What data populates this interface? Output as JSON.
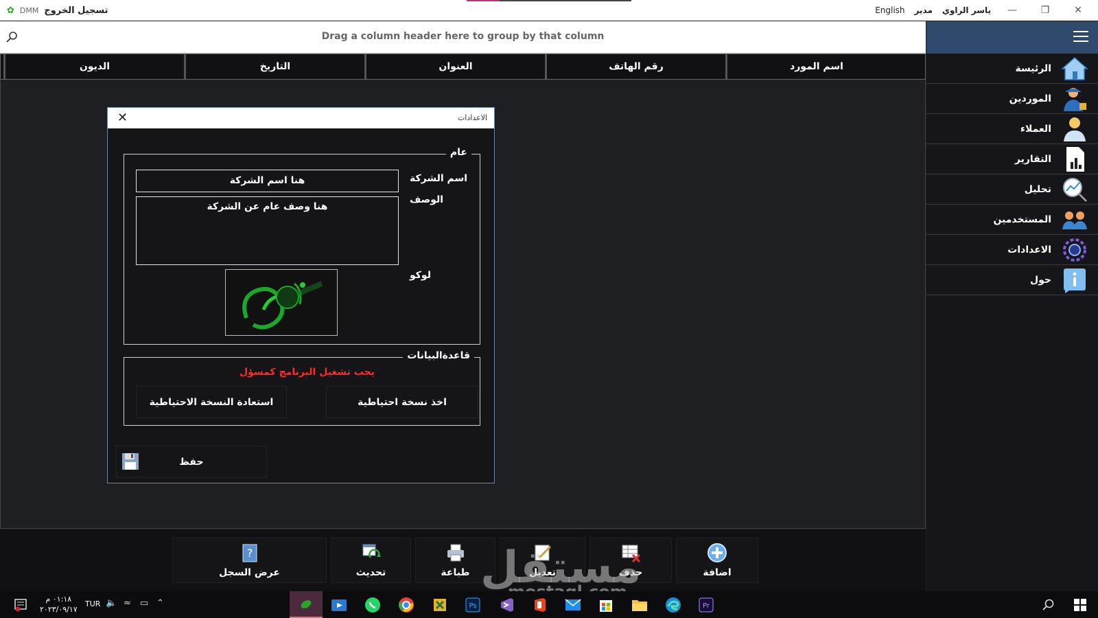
{
  "titlebar": {
    "app_code": "DMM",
    "logout_label": "تسجيل الخروج",
    "language": "English",
    "role": "مدير",
    "user_name": "ياسر الراوي"
  },
  "groupbar": {
    "hint": "Drag a column header here to group by that column"
  },
  "grid": {
    "columns": [
      "اسم المورد",
      "رقم الهاتف",
      "العنوان",
      "التاريخ",
      "الديون"
    ]
  },
  "sidebar": {
    "items": [
      {
        "label": "الرئيسة",
        "icon": "home-icon"
      },
      {
        "label": "الموردين",
        "icon": "supplier-icon"
      },
      {
        "label": "العملاء",
        "icon": "customer-icon"
      },
      {
        "label": "التقارير",
        "icon": "report-icon"
      },
      {
        "label": "تحليل",
        "icon": "analysis-icon"
      },
      {
        "label": "المستخدمين",
        "icon": "users-icon"
      },
      {
        "label": "الاعدادات",
        "icon": "settings-icon"
      },
      {
        "label": "حول",
        "icon": "info-icon"
      }
    ]
  },
  "toolbar": {
    "add_label": "اضافة",
    "delete_label": "حذف",
    "edit_label": "تعديل",
    "print_label": "طباعة",
    "refresh_label": "تحديث",
    "log_label": "عرض السجل"
  },
  "dialog": {
    "title": "الاعدادات",
    "general_legend": "عام",
    "company_name_label": "اسم الشركة",
    "company_name_value": "هنا اسم الشركة",
    "description_label": "الوصف",
    "description_value": "هنا وصف عام عن الشركة",
    "logo_label": "لوكو",
    "database_legend": "قاعدةالبيانات",
    "admin_warning": "يجب تشغيل البرنامج كمسؤل",
    "backup_label": "اخذ نسخة احتياطية",
    "restore_label": "استعادة النسخة الاحتياطية",
    "save_label": "حفظ"
  },
  "taskbar": {
    "time": "٠١:١٨ م",
    "date": "٢٠٢٣/٠٩/١٧",
    "input_lang": "TUR"
  },
  "watermark": {
    "text": "مستقل",
    "domain": "mostaql.com"
  },
  "colors": {
    "sidebar_header": "#2f4a6c",
    "warning": "#ff2a2a",
    "dialog_border": "#6a8bb0"
  }
}
